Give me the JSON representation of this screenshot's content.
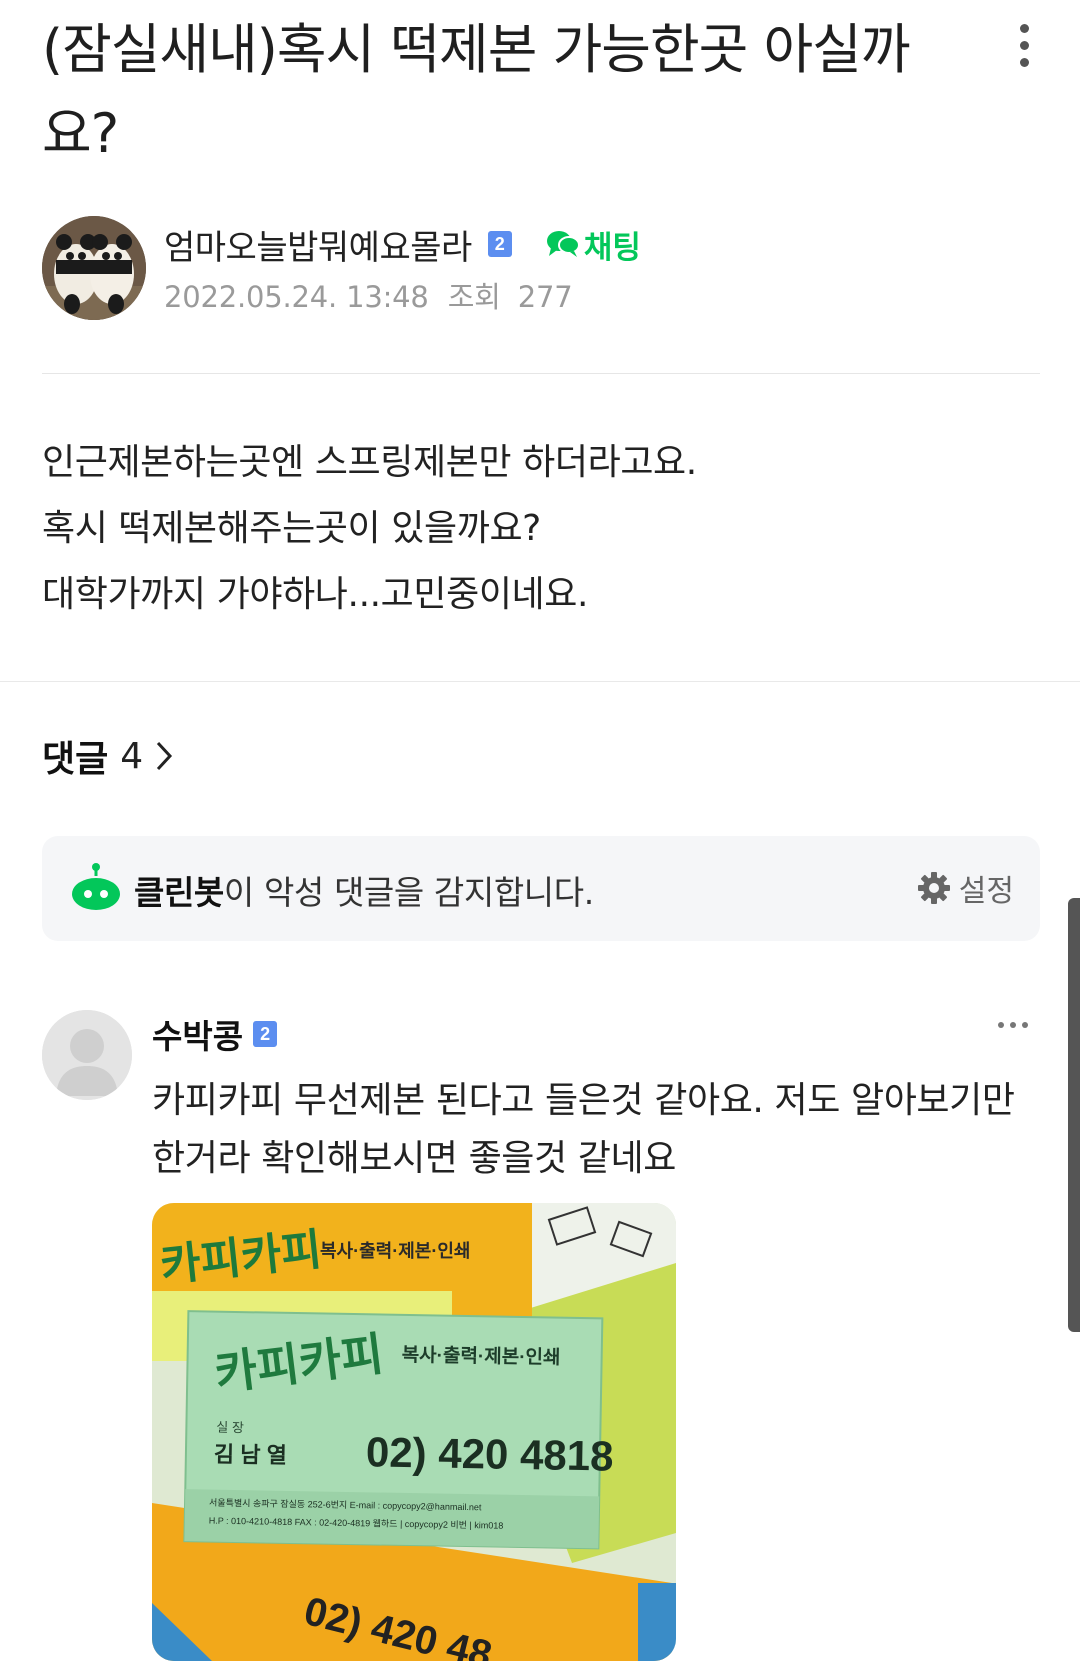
{
  "post": {
    "title": "(잠실새내)혹시 떡제본 가능한곳 아실까요?",
    "author": {
      "nickname": "엄마오늘밥뭐예요몰라",
      "level": "2",
      "chat_label": "채팅",
      "date": "2022.05.24. 13:48",
      "views_label": "조회",
      "views": "277"
    },
    "body": [
      "인근제본하는곳엔 스프링제본만 하더라고요.",
      "혹시 떡제본해주는곳이 있을까요?",
      "대학가까지 가야하나...고민중이네요."
    ]
  },
  "comments_header": {
    "label": "댓글",
    "count": "4"
  },
  "cleanbot": {
    "name": "클린봇",
    "message": "이 악성 댓글을 감지합니다.",
    "settings_label": "설정"
  },
  "comments": [
    {
      "nickname": "수박콩",
      "level": "2",
      "text": "카피카피 무선제본 된다고 들은것 같아요. 저도 알아보기만 한거라 확인해보시면 좋을것 같네요",
      "photo": {
        "card_front": {
          "services": "복사·출력·제본·인쇄",
          "title": "실 장",
          "name": "김 남 열",
          "phone": "02) 420 4818",
          "address": "서울특별시 송파구 잠실동 252-6번지  E-mail : copycopy2@hanmail.net",
          "contact": "H.P : 010-4210-4818   FAX : 02-420-4819   웹하드 | copycopy2  비번 | kim018"
        },
        "card_back_phone": "02) 420 48"
      }
    }
  ],
  "colors": {
    "accent_green": "#03c75a",
    "level_badge": "#5c8ef0"
  }
}
